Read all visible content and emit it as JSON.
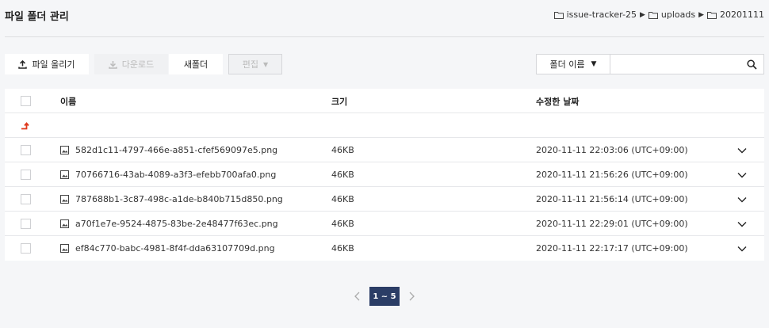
{
  "header": {
    "title": "파일 폴더 관리",
    "breadcrumb": [
      "issue-tracker-25",
      "uploads",
      "20201111"
    ]
  },
  "toolbar": {
    "upload_label": "파일 올리기",
    "download_label": "다운로드",
    "new_folder_label": "새폴더",
    "edit_label": "편집",
    "search_select": "폴더 이름",
    "search_value": ""
  },
  "table": {
    "columns": {
      "name": "이름",
      "size": "크기",
      "date": "수정한 날짜"
    },
    "rows": [
      {
        "name": "582d1c11-4797-466e-a851-cfef569097e5.png",
        "size": "46KB",
        "date": "2020-11-11 22:03:06 (UTC+09:00)"
      },
      {
        "name": "70766716-43ab-4089-a3f3-efebb700afa0.png",
        "size": "46KB",
        "date": "2020-11-11 21:56:26 (UTC+09:00)"
      },
      {
        "name": "787688b1-3c87-498c-a1de-b840b715d850.png",
        "size": "46KB",
        "date": "2020-11-11 21:56:14 (UTC+09:00)"
      },
      {
        "name": "a70f1e7e-9524-4875-83be-2e48477f63ec.png",
        "size": "46KB",
        "date": "2020-11-11 22:29:01 (UTC+09:00)"
      },
      {
        "name": "ef84c770-babc-4981-8f4f-dda63107709d.png",
        "size": "46KB",
        "date": "2020-11-11 22:17:17 (UTC+09:00)"
      }
    ]
  },
  "pager": {
    "current": "1 ~ 5"
  },
  "colors": {
    "accent": "#2b3d66",
    "parent_arrow": "#e03a1e"
  }
}
